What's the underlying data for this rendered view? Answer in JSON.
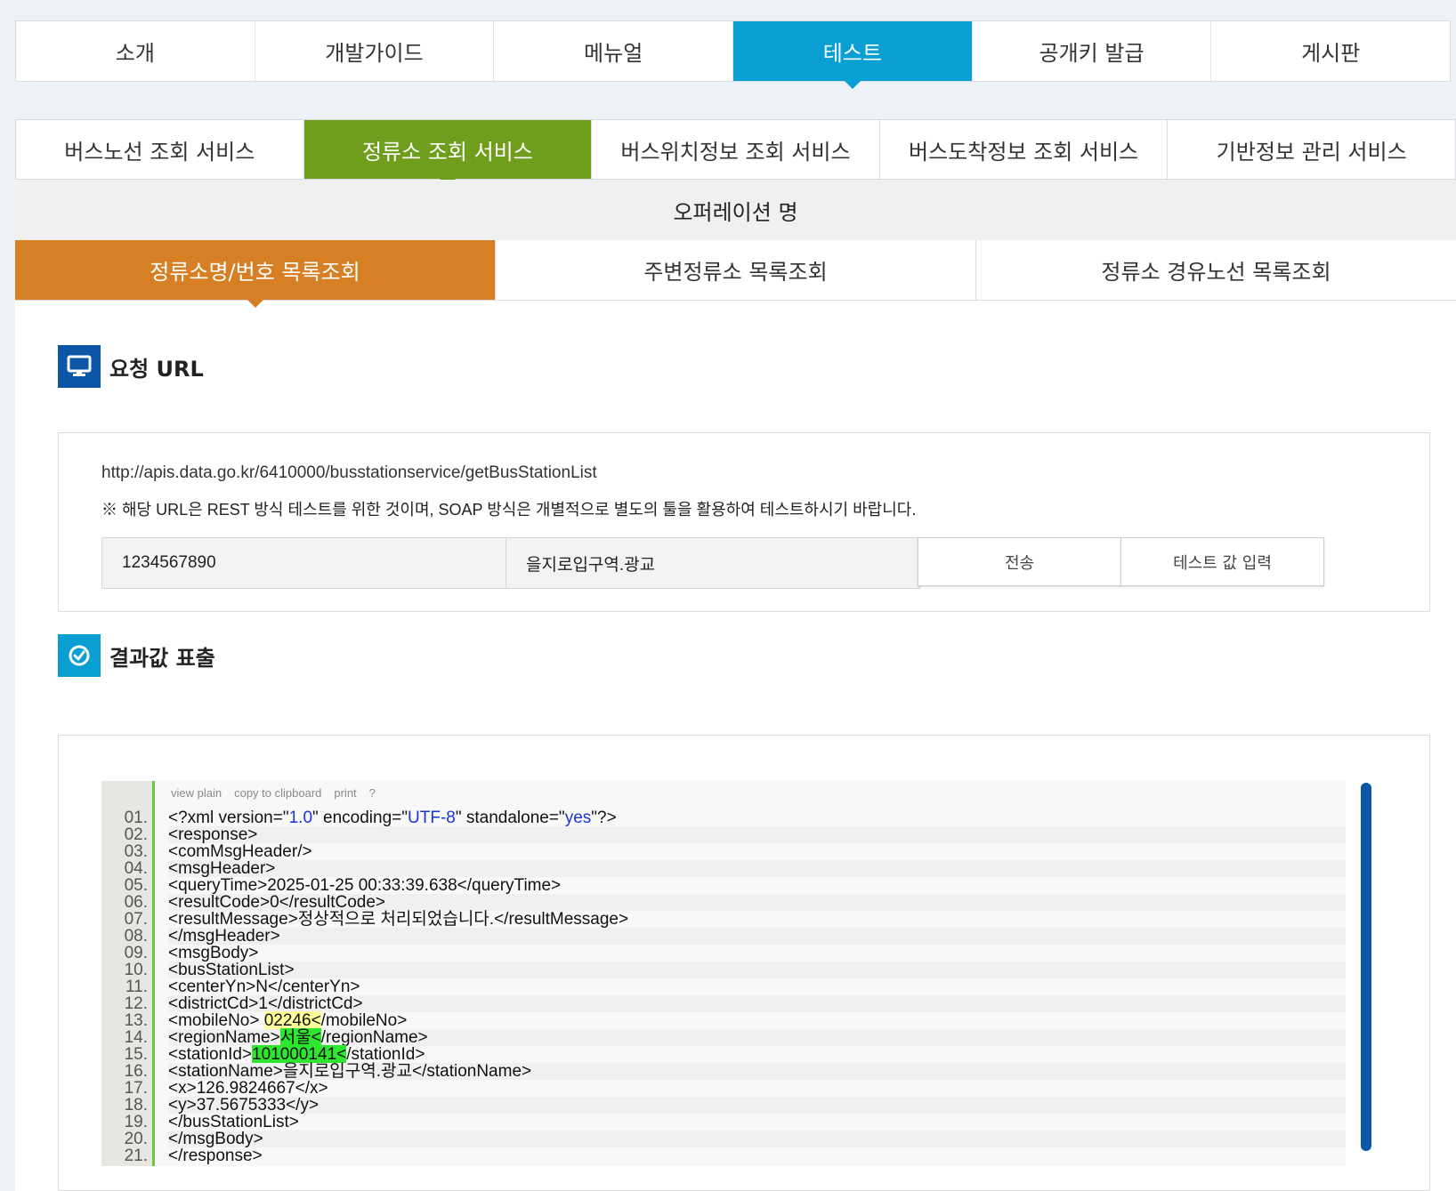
{
  "top_nav": {
    "tabs": [
      "소개",
      "개발가이드",
      "메뉴얼",
      "테스트",
      "공개키 발급",
      "게시판"
    ],
    "active_index": 3
  },
  "service_tabs": {
    "tabs": [
      "버스노선 조회 서비스",
      "정류소 조회 서비스",
      "버스위치정보 조회 서비스",
      "버스도착정보 조회 서비스",
      "기반정보 관리 서비스"
    ],
    "active_index": 1
  },
  "operation": {
    "header": "오퍼레이션 명",
    "tabs": [
      "정류소명/번호 목록조회",
      "주변정류소 목록조회",
      "정류소 경유노선 목록조회"
    ],
    "active_index": 0
  },
  "request": {
    "icon": "monitor-icon",
    "title": "요청 URL",
    "url": "http://apis.data.go.kr/6410000/busstationservice/getBusStationList",
    "note": "※ 해당 URL은 REST 방식 테스트를 위한 것이며, SOAP 방식은 개별적으로 별도의 툴을 활용하여 테스트하시기 바랍니다.",
    "input1_value": "1234567890",
    "input2_value": "을지로입구역.광교",
    "send_label": "전송",
    "test_value_label": "테스트 값 입력"
  },
  "result": {
    "icon": "check-circle-icon",
    "title": "결과값 표출",
    "toolbar": [
      "view plain",
      "copy to clipboard",
      "print",
      "?"
    ],
    "lines": [
      {
        "n": "01.",
        "pre": "<?xml version=",
        "parts": [
          [
            "\"",
            ""
          ],
          [
            "1.0",
            "val"
          ],
          [
            "\" encoding=\"",
            ""
          ],
          [
            "UTF-8",
            "val"
          ],
          [
            "\" standalone=\"",
            ""
          ],
          [
            "yes",
            "val"
          ],
          [
            "\"?>",
            ""
          ]
        ]
      },
      {
        "n": "02.",
        "parts": [
          [
            "<response>",
            ""
          ]
        ]
      },
      {
        "n": "03.",
        "parts": [
          [
            "<comMsgHeader/>",
            ""
          ]
        ]
      },
      {
        "n": "04.",
        "parts": [
          [
            "<msgHeader>",
            ""
          ]
        ]
      },
      {
        "n": "05.",
        "parts": [
          [
            "<queryTime>2025-01-25 00:33:39.638</queryTime>",
            ""
          ]
        ]
      },
      {
        "n": "06.",
        "parts": [
          [
            "<resultCode>0</resultCode>",
            ""
          ]
        ]
      },
      {
        "n": "07.",
        "parts": [
          [
            "<resultMessage>정상적으로 처리되었습니다.</resultMessage>",
            ""
          ]
        ]
      },
      {
        "n": "08.",
        "parts": [
          [
            "</msgHeader>",
            ""
          ]
        ]
      },
      {
        "n": "09.",
        "parts": [
          [
            "<msgBody>",
            ""
          ]
        ]
      },
      {
        "n": "10.",
        "parts": [
          [
            "<busStationList>",
            ""
          ]
        ]
      },
      {
        "n": "11.",
        "parts": [
          [
            "<centerYn>N</centerYn>",
            ""
          ]
        ]
      },
      {
        "n": "12.",
        "parts": [
          [
            "<districtCd>1</districtCd>",
            ""
          ]
        ]
      },
      {
        "n": "13.",
        "parts": [
          [
            "<mobileNo> ",
            ""
          ],
          [
            "02246<",
            "yellow"
          ],
          [
            "/mobileNo>",
            ""
          ]
        ]
      },
      {
        "n": "14.",
        "parts": [
          [
            "<regionName>",
            ""
          ],
          [
            "서울<",
            "green"
          ],
          [
            "/regionName>",
            ""
          ]
        ]
      },
      {
        "n": "15.",
        "parts": [
          [
            "<stationId>",
            ""
          ],
          [
            "101000141<",
            "green"
          ],
          [
            "/stationId>",
            ""
          ]
        ]
      },
      {
        "n": "16.",
        "parts": [
          [
            "<stationName>을지로입구역.광교</stationName>",
            ""
          ]
        ]
      },
      {
        "n": "17.",
        "parts": [
          [
            "<x>126.9824667</x>",
            ""
          ]
        ]
      },
      {
        "n": "18.",
        "parts": [
          [
            "<y>37.5675333</y>",
            ""
          ]
        ]
      },
      {
        "n": "19.",
        "parts": [
          [
            "</busStationList>",
            ""
          ]
        ]
      },
      {
        "n": "20.",
        "parts": [
          [
            "</msgBody>",
            ""
          ]
        ]
      },
      {
        "n": "21.",
        "parts": [
          [
            "</response>",
            ""
          ]
        ]
      }
    ]
  },
  "colors": {
    "top_active": "#0a9fd3",
    "service_active": "#6e9e1c",
    "operation_active": "#d77f24",
    "scrollbar": "#0b56a6"
  }
}
